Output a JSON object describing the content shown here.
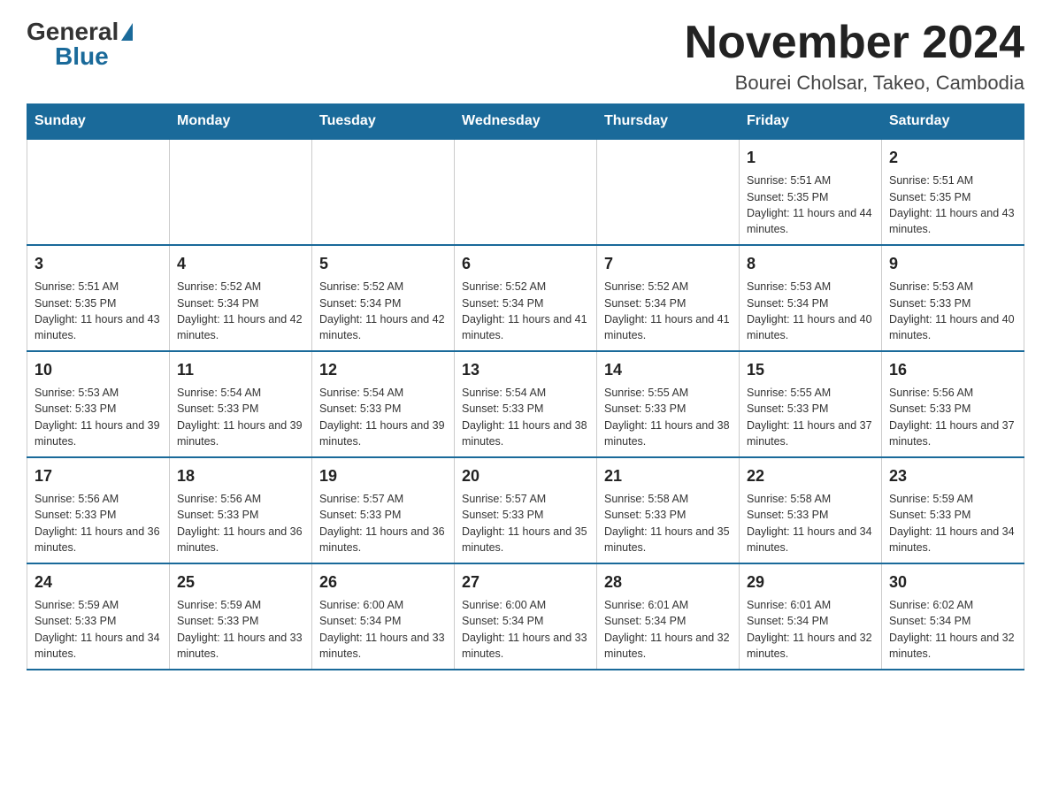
{
  "header": {
    "logo_general": "General",
    "logo_blue": "Blue",
    "month_title": "November 2024",
    "location": "Bourei Cholsar, Takeo, Cambodia"
  },
  "calendar": {
    "days_of_week": [
      "Sunday",
      "Monday",
      "Tuesday",
      "Wednesday",
      "Thursday",
      "Friday",
      "Saturday"
    ],
    "weeks": [
      [
        {
          "day": "",
          "info": ""
        },
        {
          "day": "",
          "info": ""
        },
        {
          "day": "",
          "info": ""
        },
        {
          "day": "",
          "info": ""
        },
        {
          "day": "",
          "info": ""
        },
        {
          "day": "1",
          "info": "Sunrise: 5:51 AM\nSunset: 5:35 PM\nDaylight: 11 hours and 44 minutes."
        },
        {
          "day": "2",
          "info": "Sunrise: 5:51 AM\nSunset: 5:35 PM\nDaylight: 11 hours and 43 minutes."
        }
      ],
      [
        {
          "day": "3",
          "info": "Sunrise: 5:51 AM\nSunset: 5:35 PM\nDaylight: 11 hours and 43 minutes."
        },
        {
          "day": "4",
          "info": "Sunrise: 5:52 AM\nSunset: 5:34 PM\nDaylight: 11 hours and 42 minutes."
        },
        {
          "day": "5",
          "info": "Sunrise: 5:52 AM\nSunset: 5:34 PM\nDaylight: 11 hours and 42 minutes."
        },
        {
          "day": "6",
          "info": "Sunrise: 5:52 AM\nSunset: 5:34 PM\nDaylight: 11 hours and 41 minutes."
        },
        {
          "day": "7",
          "info": "Sunrise: 5:52 AM\nSunset: 5:34 PM\nDaylight: 11 hours and 41 minutes."
        },
        {
          "day": "8",
          "info": "Sunrise: 5:53 AM\nSunset: 5:34 PM\nDaylight: 11 hours and 40 minutes."
        },
        {
          "day": "9",
          "info": "Sunrise: 5:53 AM\nSunset: 5:33 PM\nDaylight: 11 hours and 40 minutes."
        }
      ],
      [
        {
          "day": "10",
          "info": "Sunrise: 5:53 AM\nSunset: 5:33 PM\nDaylight: 11 hours and 39 minutes."
        },
        {
          "day": "11",
          "info": "Sunrise: 5:54 AM\nSunset: 5:33 PM\nDaylight: 11 hours and 39 minutes."
        },
        {
          "day": "12",
          "info": "Sunrise: 5:54 AM\nSunset: 5:33 PM\nDaylight: 11 hours and 39 minutes."
        },
        {
          "day": "13",
          "info": "Sunrise: 5:54 AM\nSunset: 5:33 PM\nDaylight: 11 hours and 38 minutes."
        },
        {
          "day": "14",
          "info": "Sunrise: 5:55 AM\nSunset: 5:33 PM\nDaylight: 11 hours and 38 minutes."
        },
        {
          "day": "15",
          "info": "Sunrise: 5:55 AM\nSunset: 5:33 PM\nDaylight: 11 hours and 37 minutes."
        },
        {
          "day": "16",
          "info": "Sunrise: 5:56 AM\nSunset: 5:33 PM\nDaylight: 11 hours and 37 minutes."
        }
      ],
      [
        {
          "day": "17",
          "info": "Sunrise: 5:56 AM\nSunset: 5:33 PM\nDaylight: 11 hours and 36 minutes."
        },
        {
          "day": "18",
          "info": "Sunrise: 5:56 AM\nSunset: 5:33 PM\nDaylight: 11 hours and 36 minutes."
        },
        {
          "day": "19",
          "info": "Sunrise: 5:57 AM\nSunset: 5:33 PM\nDaylight: 11 hours and 36 minutes."
        },
        {
          "day": "20",
          "info": "Sunrise: 5:57 AM\nSunset: 5:33 PM\nDaylight: 11 hours and 35 minutes."
        },
        {
          "day": "21",
          "info": "Sunrise: 5:58 AM\nSunset: 5:33 PM\nDaylight: 11 hours and 35 minutes."
        },
        {
          "day": "22",
          "info": "Sunrise: 5:58 AM\nSunset: 5:33 PM\nDaylight: 11 hours and 34 minutes."
        },
        {
          "day": "23",
          "info": "Sunrise: 5:59 AM\nSunset: 5:33 PM\nDaylight: 11 hours and 34 minutes."
        }
      ],
      [
        {
          "day": "24",
          "info": "Sunrise: 5:59 AM\nSunset: 5:33 PM\nDaylight: 11 hours and 34 minutes."
        },
        {
          "day": "25",
          "info": "Sunrise: 5:59 AM\nSunset: 5:33 PM\nDaylight: 11 hours and 33 minutes."
        },
        {
          "day": "26",
          "info": "Sunrise: 6:00 AM\nSunset: 5:34 PM\nDaylight: 11 hours and 33 minutes."
        },
        {
          "day": "27",
          "info": "Sunrise: 6:00 AM\nSunset: 5:34 PM\nDaylight: 11 hours and 33 minutes."
        },
        {
          "day": "28",
          "info": "Sunrise: 6:01 AM\nSunset: 5:34 PM\nDaylight: 11 hours and 32 minutes."
        },
        {
          "day": "29",
          "info": "Sunrise: 6:01 AM\nSunset: 5:34 PM\nDaylight: 11 hours and 32 minutes."
        },
        {
          "day": "30",
          "info": "Sunrise: 6:02 AM\nSunset: 5:34 PM\nDaylight: 11 hours and 32 minutes."
        }
      ]
    ]
  }
}
